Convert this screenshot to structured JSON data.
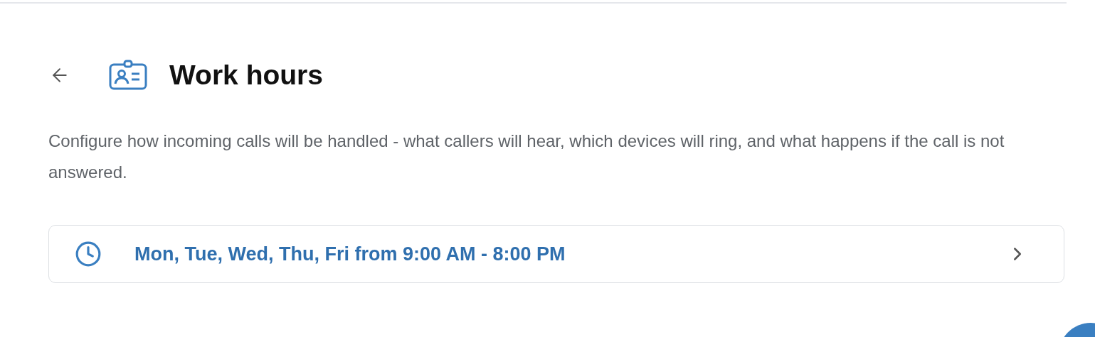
{
  "header": {
    "title": "Work hours"
  },
  "description": "Configure how incoming calls will be handled - what callers will hear, which devices will ring, and what happens if the call is not answered.",
  "schedule": {
    "label": "Mon, Tue, Wed, Thu, Fri from 9:00 AM - 8:00 PM"
  }
}
